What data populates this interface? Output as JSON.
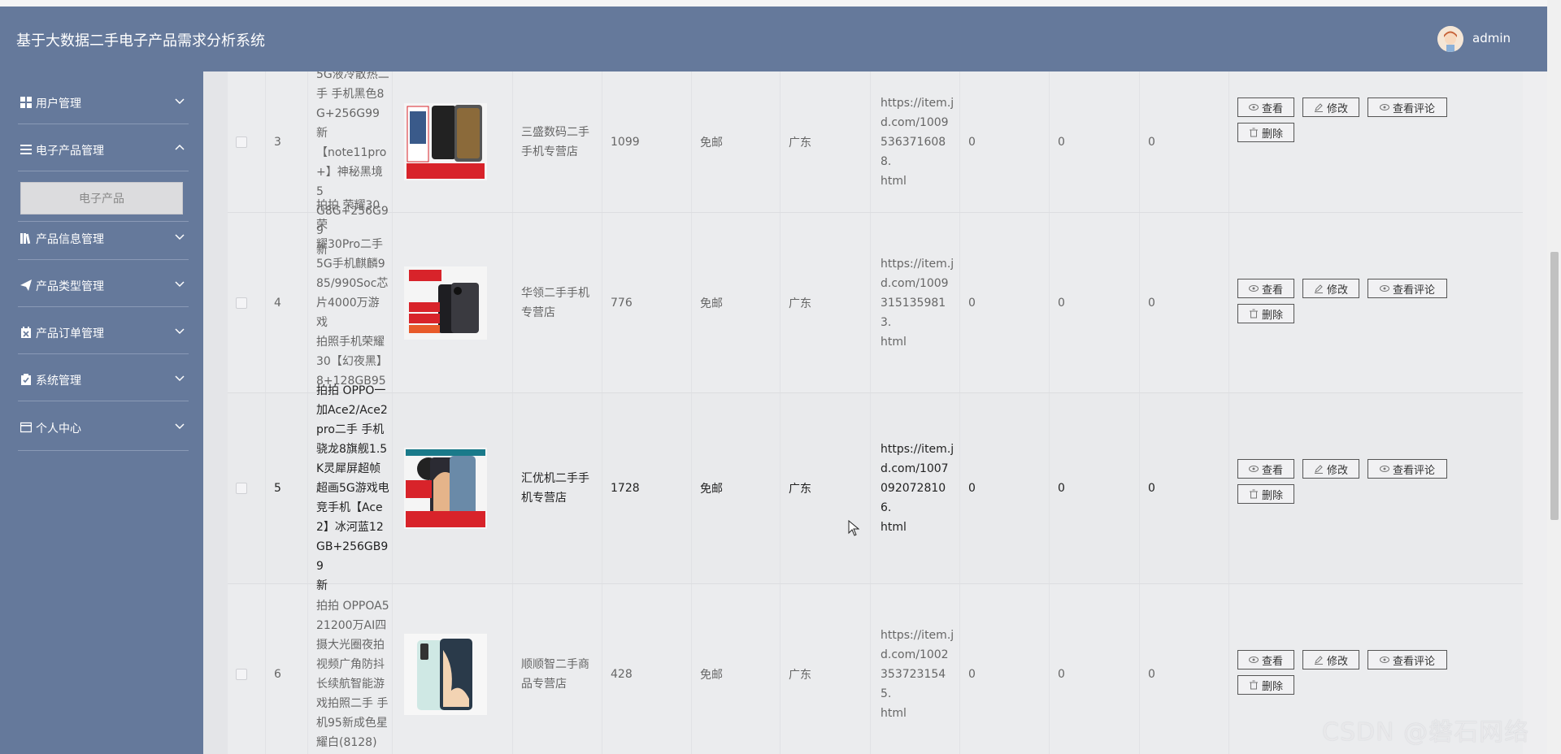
{
  "header": {
    "title": "基于大数据二手电子产品需求分析系统",
    "username": "admin"
  },
  "sidebar": {
    "items": [
      {
        "label": "用户管理",
        "icon": "grid-icon"
      },
      {
        "label": "电子产品管理",
        "icon": "list-icon",
        "submenu": "电子产品"
      },
      {
        "label": "产品信息管理",
        "icon": "library-icon"
      },
      {
        "label": "产品类型管理",
        "icon": "send-icon"
      },
      {
        "label": "产品订单管理",
        "icon": "calendar-x-icon"
      },
      {
        "label": "系统管理",
        "icon": "clipboard-icon"
      },
      {
        "label": "个人中心",
        "icon": "card-icon"
      }
    ]
  },
  "table": {
    "buttons": {
      "view": "查看",
      "edit": "修改",
      "comments": "查看评论",
      "delete": "删除"
    },
    "rows": [
      {
        "index": "3",
        "name_lines": [
          "5G液冷散热二",
          "手 手机黑色8",
          "G+256G99新",
          "【note11pro",
          "+】神秘黑境5",
          "G8G+256G99",
          "新"
        ],
        "shop_lines": [
          "三盛数码二手",
          "手机专营店"
        ],
        "price": "1099",
        "shipping": "免邮",
        "region": "广东",
        "url_lines": [
          "https://item.j",
          "d.com/1009",
          "5363716088.",
          "html"
        ],
        "a": "0",
        "b": "0",
        "c": "0"
      },
      {
        "index": "4",
        "name_lines": [
          "拍拍 荣耀30荣",
          "耀30Pro二手",
          "5G手机麒麟9",
          "85/990Soc芯",
          "片4000万游戏",
          "拍照手机荣耀",
          "30【幻夜黑】",
          "8+128GB95",
          "新"
        ],
        "shop_lines": [
          "华领二手手机",
          "专营店"
        ],
        "price": "776",
        "shipping": "免邮",
        "region": "广东",
        "url_lines": [
          "https://item.j",
          "d.com/1009",
          "3151359813.",
          "html"
        ],
        "a": "0",
        "b": "0",
        "c": "0"
      },
      {
        "index": "5",
        "name_lines": [
          "拍拍 OPPO一",
          "加Ace2/Ace2",
          "pro二手 手机",
          "骁龙8旗舰1.5",
          "K灵犀屏超帧",
          "超画5G游戏电",
          "竞手机【Ace",
          "2】冰河蓝12",
          "GB+256GB99",
          "新"
        ],
        "shop_lines": [
          "汇优机二手手",
          "机专营店"
        ],
        "price": "1728",
        "shipping": "免邮",
        "region": "广东",
        "url_lines": [
          "https://item.j",
          "d.com/1007",
          "0920728106.",
          "html"
        ],
        "a": "0",
        "b": "0",
        "c": "0"
      },
      {
        "index": "6",
        "name_lines": [
          "拍拍 OPPOA5",
          "21200万AI四",
          "摄大光圈夜拍",
          "视频广角防抖",
          "长续航智能游",
          "戏拍照二手 手",
          "机95新成色星",
          "耀白(8128)"
        ],
        "shop_lines": [
          "顺顺智二手商",
          "品专营店"
        ],
        "price": "428",
        "shipping": "免邮",
        "region": "广东",
        "url_lines": [
          "https://item.j",
          "d.com/1002",
          "3537231545.",
          "html"
        ],
        "a": "0",
        "b": "0",
        "c": "0"
      }
    ]
  },
  "watermark": "CSDN @磐石网络",
  "colors": {
    "header": "#65799b",
    "sidebar": "#65799b",
    "content": "#eeeef0",
    "thumb_red": "#d8232a"
  }
}
